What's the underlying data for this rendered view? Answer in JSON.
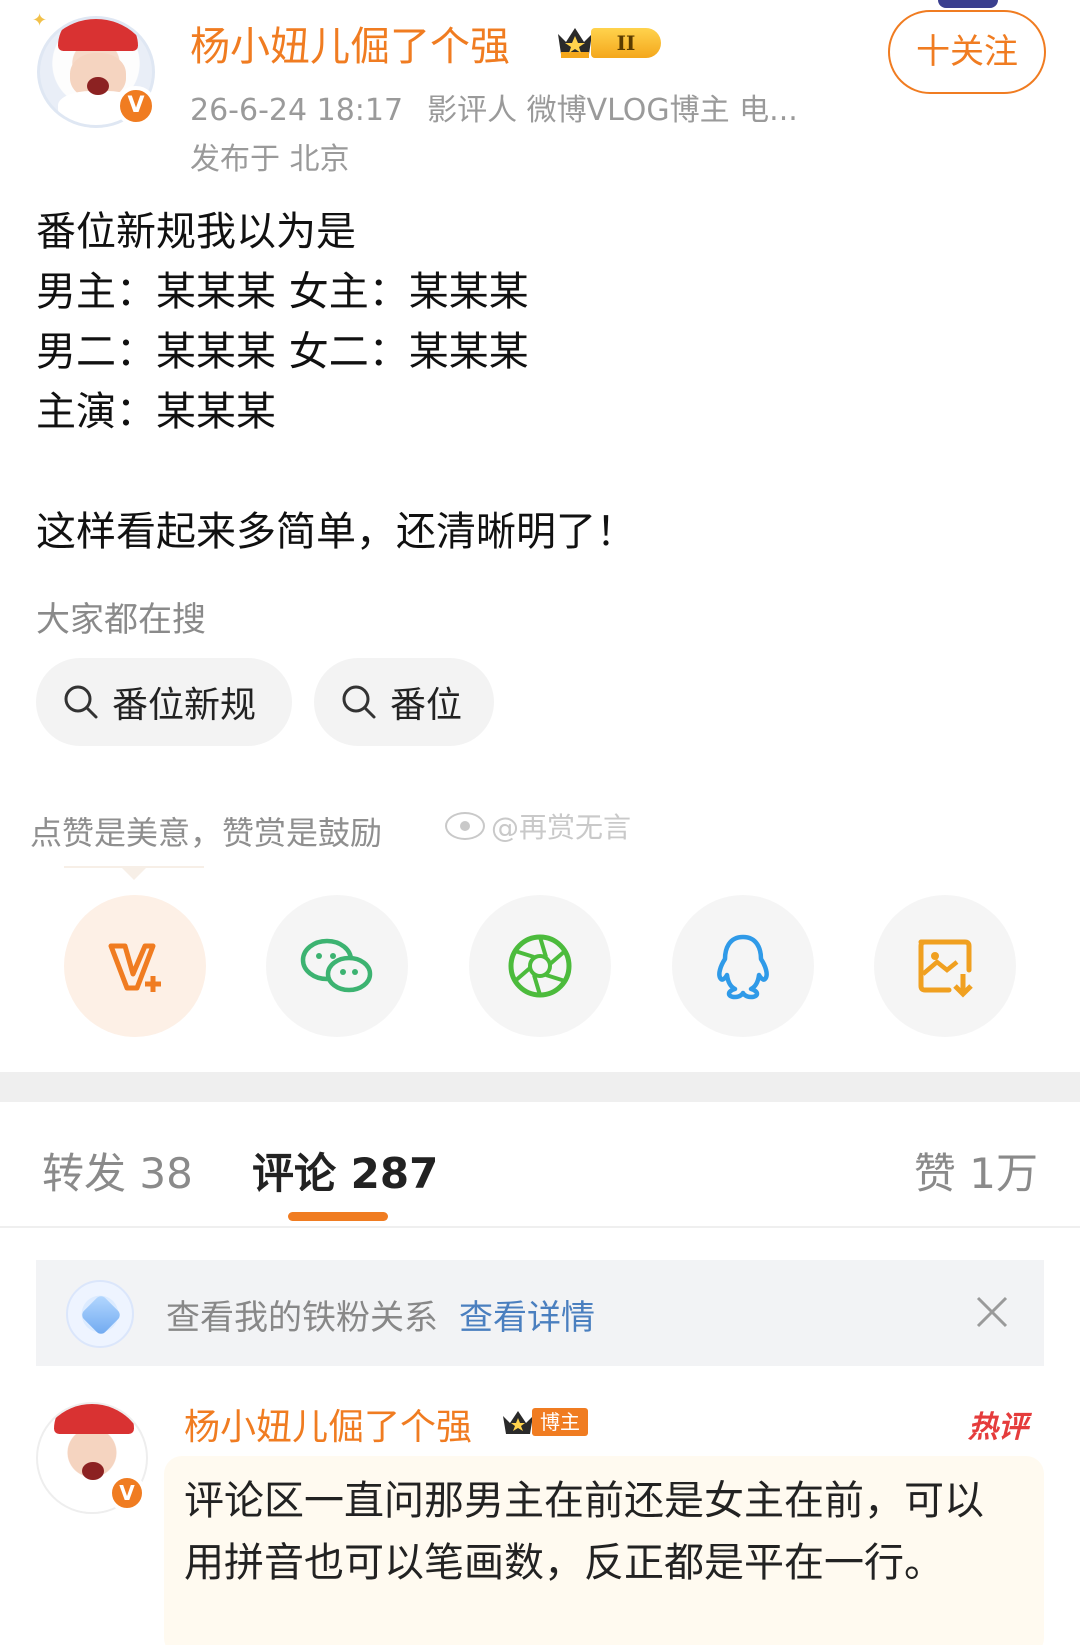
{
  "post": {
    "author": {
      "name": "杨小妞儿倔了个强",
      "level": "II",
      "verified_badge": "V"
    },
    "time": "26-6-24 18:17",
    "author_desc": "影评人 微博VLOG博主 电...",
    "location": "发布于 北京",
    "follow_label": "十关注",
    "content": "番位新规我以为是\n男主：某某某 女主：某某某\n男二：某某某 女二：某某某\n主演：某某某\n\n这样看起来多简单，还清晰明了！"
  },
  "search": {
    "label": "大家都在搜",
    "chips": [
      {
        "label": "番位新规",
        "icon": "search-icon"
      },
      {
        "label": "番位",
        "icon": "search-icon"
      }
    ]
  },
  "reward_tip": "点赞是美意，赞赏是鼓励",
  "watermark": "@再赏无言",
  "share": [
    {
      "name": "reward",
      "icon": "v-plus-icon",
      "color": "#f07c21"
    },
    {
      "name": "wechat",
      "icon": "wechat-icon",
      "color": "#3cb371"
    },
    {
      "name": "moments",
      "icon": "aperture-icon",
      "color": "#4cbb3c"
    },
    {
      "name": "qq",
      "icon": "qq-penguin-icon",
      "color": "#2f9ae8"
    },
    {
      "name": "save-image",
      "icon": "image-download-icon",
      "color": "#f0a020"
    }
  ],
  "tabs": {
    "repost": "转发 38",
    "comment": "评论 287",
    "like": "赞 1万",
    "active": "comment"
  },
  "fan_banner": {
    "text": "查看我的铁粉关系",
    "link": "查看详情"
  },
  "comment": {
    "name": "杨小妞儿倔了个强",
    "badge": "博主",
    "hot_label": "热评",
    "text": "评论区一直问那男主在前还是女主在前，可以用拼音也可以笔画数，反正都是平在一行。"
  },
  "colors": {
    "accent": "#f07c21",
    "link": "#4a7fbf",
    "muted": "#9a9a9a"
  }
}
